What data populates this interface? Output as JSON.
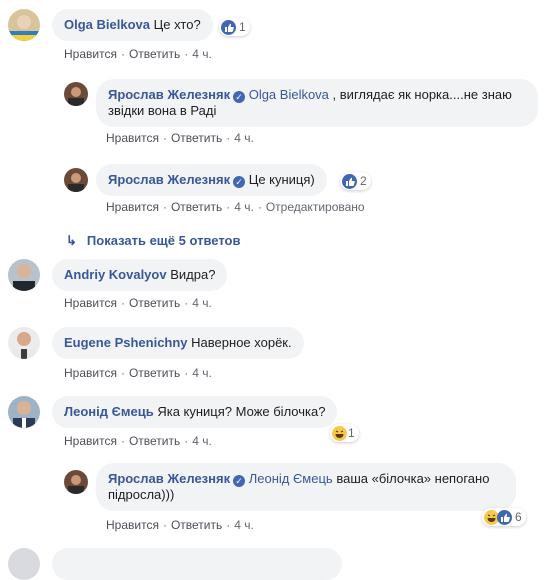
{
  "actions": {
    "like": "Нравится",
    "reply": "Ответить",
    "edited": "Отредактировано"
  },
  "comments": [
    {
      "author": "Olga Bielkova",
      "text": "Це хто?",
      "time": "4 ч.",
      "reaction_count": "1"
    },
    {
      "author": "Ярослав Железняк",
      "mention": "Olga Bielkova",
      "text": ", виглядає як норка....не знаю звідки вона в Раді",
      "time": "4 ч."
    },
    {
      "author": "Ярослав Железняк",
      "text": "Це куниця)",
      "time": "4 ч.",
      "reaction_count": "2"
    },
    {
      "author": "Andriy Kovalyov",
      "text": "Видра?",
      "time": "4 ч."
    },
    {
      "author": "Eugene Pshenichny",
      "text": "Наверное хорёк.",
      "time": "4 ч."
    },
    {
      "author": "Леонід Ємець",
      "text": "Яка куниця? Може білочка?",
      "time": "4 ч.",
      "reaction_count": "1"
    },
    {
      "author": "Ярослав Железняк",
      "mention": "Леонід Ємець",
      "text": "ваша «білочка» непогано підросла)))",
      "time": "4 ч.",
      "reaction_count": "6"
    }
  ],
  "more_replies": "Показать ещё 5 ответов",
  "icons": {
    "like": "like-icon",
    "haha": "haha-icon",
    "verified": "verified-badge-icon",
    "reply_arrow": "reply-arrow-icon"
  },
  "colors": {
    "name": "#385898",
    "bubble": "#f2f3f5",
    "like": "#4267b2"
  }
}
